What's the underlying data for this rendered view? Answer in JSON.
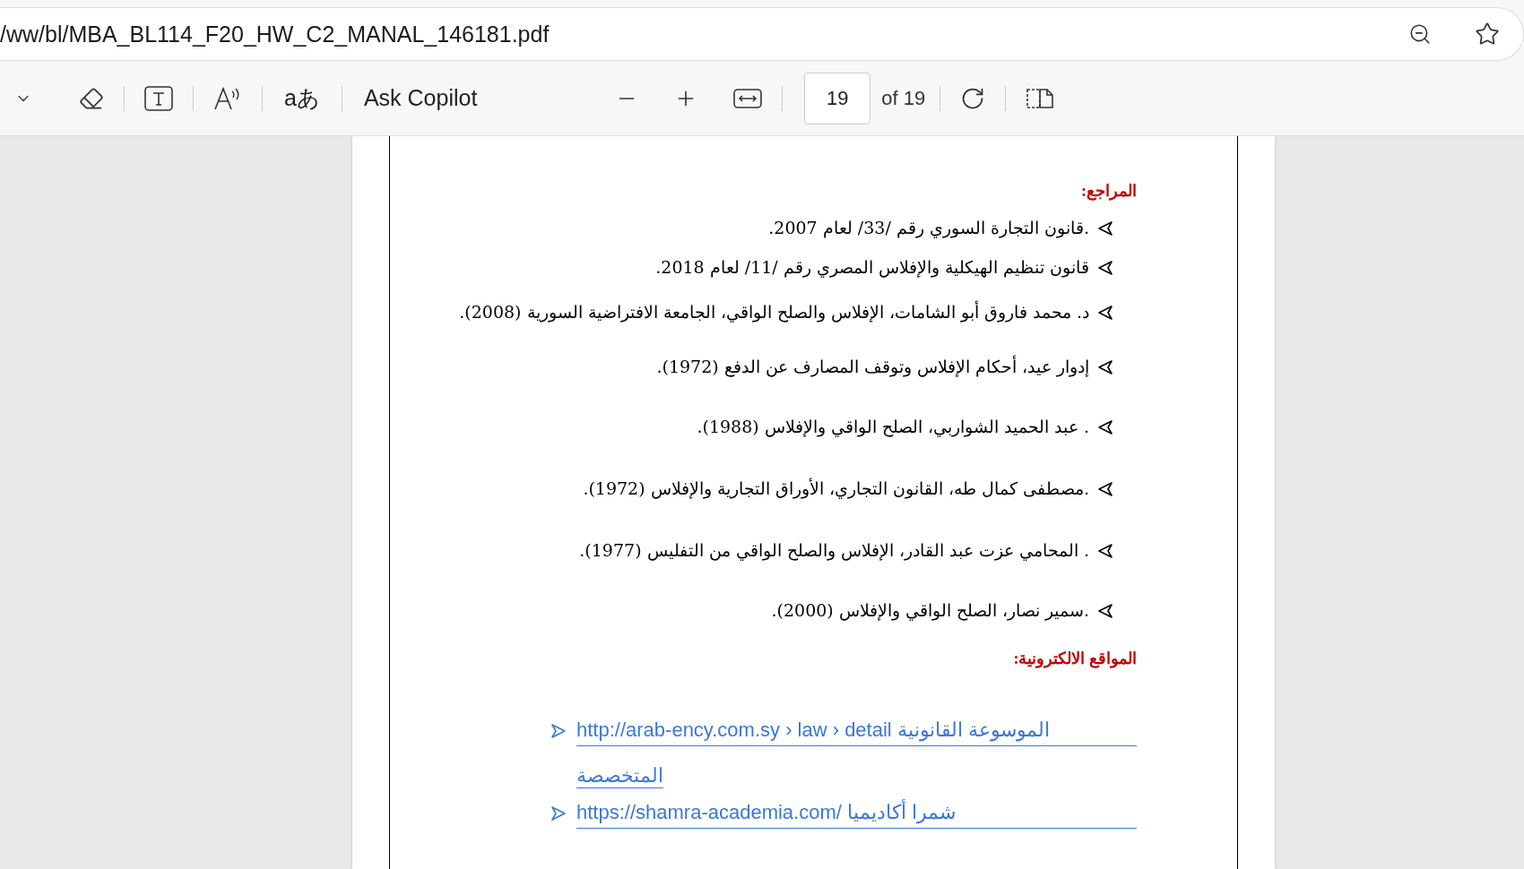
{
  "address_bar": {
    "url": "/ww/bl/MBA_BL114_F20_HW_C2_MANAL_146181.pdf"
  },
  "toolbar": {
    "translate_label": "aあ",
    "ask_copilot": "Ask Copilot",
    "page_number": "19",
    "page_total": "of 19"
  },
  "document": {
    "references_heading": "المراجع:",
    "references": [
      ".قانون التجارة السوري رقم /33/ لعام 2007.",
      "قانون تنظيم الهيكلية والإفلاس المصري رقم /11/ لعام 2018.",
      "د. محمد فاروق أبو الشامات، الإفلاس والصلح الواقي، الجامعة الافتراضية السورية (2008).",
      "إدوار  عيد، أحكام الإفلاس وتوقف المصارف عن الدفع (1972).",
      ". عبد الحميد الشواربي، الصلح الواقي والإفلاس (1988).",
      ".مصطفى كمال طه، القانون التجاري، الأوراق التجارية والإفلاس (1972).",
      ". المحامي عزت عبد القادر، الإفلاس والصلح الواقي من التفليس (1977).",
      ".سمير نصار، الصلح الواقي والإفلاس (2000)."
    ],
    "websites_heading": "المواقع الالكترونية:",
    "websites": [
      {
        "lines": [
          "http://arab-ency.com.sy › law › detail   الموسوعة   القانونية",
          "المتخصصة"
        ]
      },
      {
        "lines": [
          "https://shamra-academia.com/  شمرا أكاديميا"
        ]
      }
    ]
  }
}
